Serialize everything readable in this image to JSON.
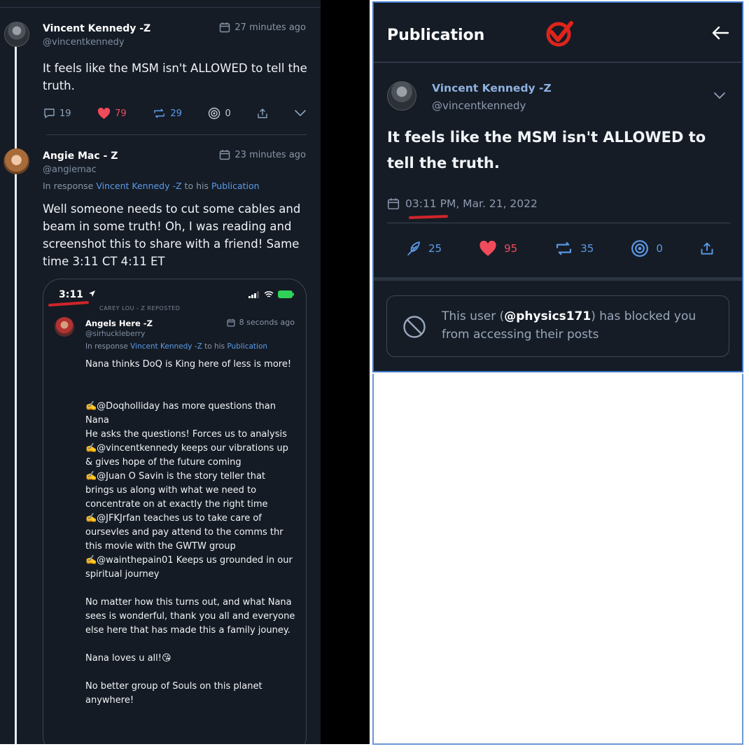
{
  "left": {
    "post1": {
      "author": "Vincent Kennedy -Z",
      "handle": "@vincentkennedy",
      "time": "27 minutes ago",
      "text": "It feels like the MSM isn't ALLOWED to tell the truth.",
      "comments": "19",
      "likes": "79",
      "reposts": "29",
      "targets": "0"
    },
    "post2": {
      "author": "Angie Mac - Z",
      "handle": "@angiemac",
      "time": "23 minutes ago",
      "reply_prefix": "In response",
      "reply_user": "Vincent Kennedy -Z",
      "reply_mid": "to his",
      "reply_link": "Publication",
      "text": "Well someone needs to cut some cables and beam in some truth! Oh, I was reading and screenshot this to share with a friend! Same time 3:11 CT 4:11 ET"
    },
    "phone": {
      "status_time": "3:11",
      "reposted": "CAREY LOU - Z REPOSTED",
      "author": "Angels Here -Z",
      "handle": "@sirhuckleberry",
      "time": "8 seconds ago",
      "reply_prefix": "In response",
      "reply_user": "Vincent Kennedy -Z",
      "reply_mid": "to his",
      "reply_link": "Publication",
      "text": "Nana thinks DoQ is King here of less is more!\n\n\n✍️@Doqholliday has more questions than Nana\nHe asks the questions! Forces us to analysis\n✍️@vincentkennedy keeps our vibrations up & gives hope of the future coming\n✍️@Juan O Savin is the story teller that brings us along with what we need to concentrate on at exactly the right time\n✍️@JFKJrfan teaches us to take care of oursevles and pay attend to the comms thr this movie with the GWTW group\n✍️@wainthepain01 Keeps us grounded in our spiritual journey\n\nNo matter how this turns out, and what Nana sees is wonderful, thank you all and everyone else here that has made this a family jouney.\n\nNana loves u all!😘\n\nNo better group of Souls on this planet anywhere!"
    }
  },
  "right": {
    "title": "Publication",
    "author": "Vincent Kennedy -Z",
    "handle": "@vincentkennedy",
    "text": "It feels like the MSM isn't ALLOWED to tell the truth.",
    "date": "03:11 PM, Mar. 21, 2022",
    "comments": "25",
    "likes": "95",
    "reposts": "35",
    "targets": "0",
    "blocked_prefix": "This user (",
    "blocked_user": "@physics171",
    "blocked_suffix": ") has blocked you from accessing their posts"
  },
  "colors": {
    "background": "#151c26",
    "accent_blue": "#5b9be8",
    "like_red": "#f04b5a",
    "annotation_red": "#d0252a"
  }
}
